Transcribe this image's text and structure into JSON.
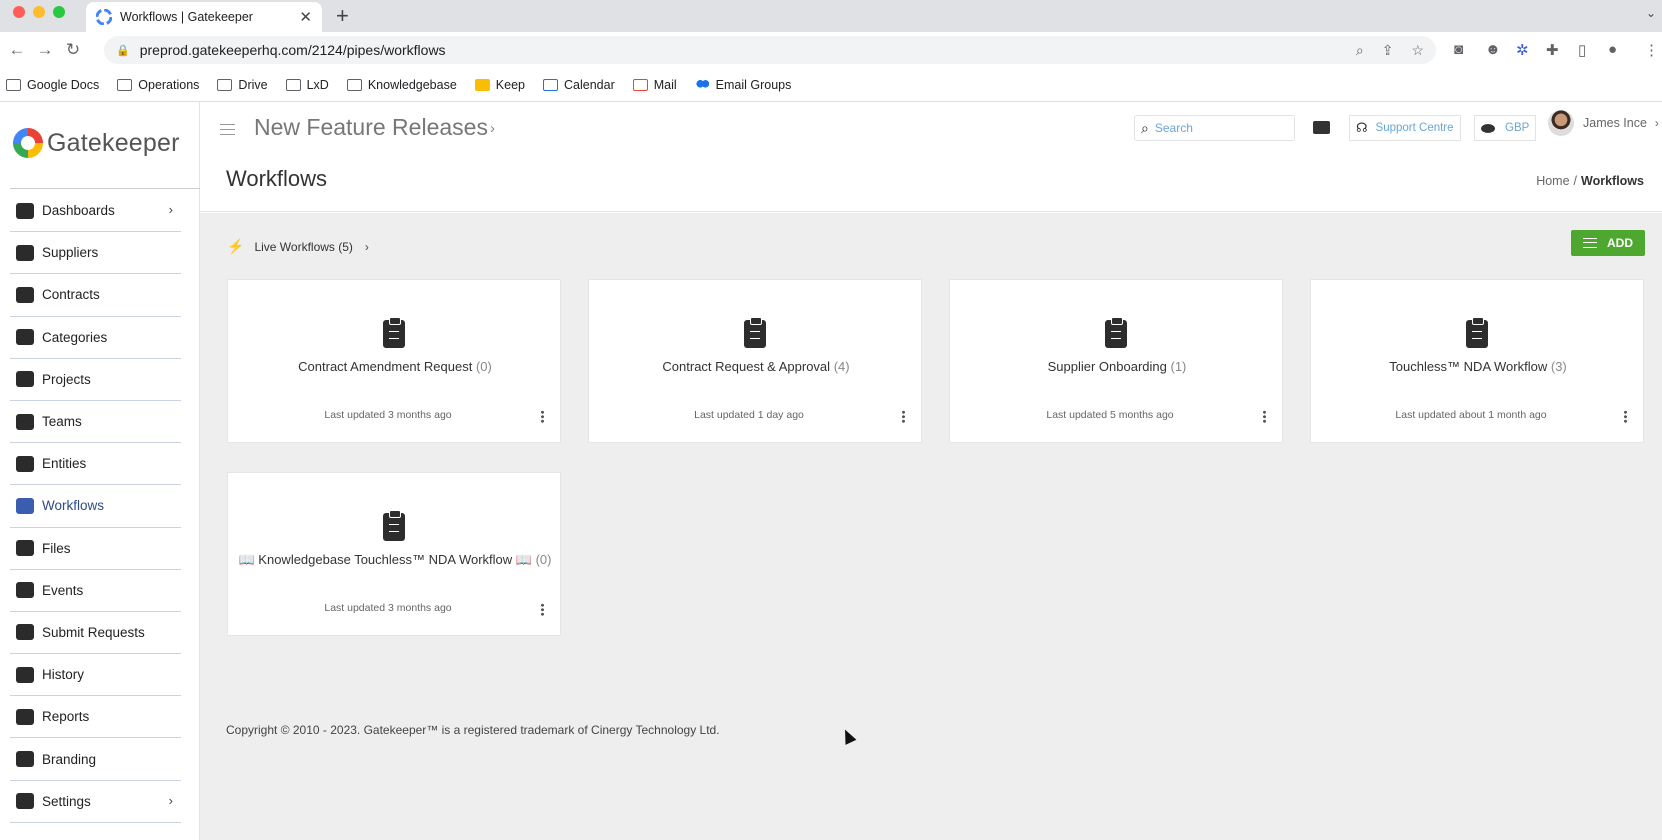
{
  "browser": {
    "tab_title": "Workflows | Gatekeeper",
    "url": "preprod.gatekeeperhq.com/2124/pipes/workflows",
    "bookmarks": [
      {
        "label": "Google Docs",
        "icon": "folder-icon"
      },
      {
        "label": "Operations",
        "icon": "folder-icon"
      },
      {
        "label": "Drive",
        "icon": "folder-icon"
      },
      {
        "label": "LxD",
        "icon": "folder-icon"
      },
      {
        "label": "Knowledgebase",
        "icon": "folder-icon"
      },
      {
        "label": "Keep",
        "icon": "keep-icon"
      },
      {
        "label": "Calendar",
        "icon": "calendar-icon"
      },
      {
        "label": "Mail",
        "icon": "gmail-icon"
      },
      {
        "label": "Email Groups",
        "icon": "groups-icon"
      }
    ]
  },
  "brand": {
    "name": "Gatekeeper",
    "accent": "#4ea72f"
  },
  "sidebar": {
    "items": [
      {
        "label": "Dashboards",
        "icon": "dashboard-icon",
        "has_submenu": true
      },
      {
        "label": "Suppliers",
        "icon": "supplier-icon"
      },
      {
        "label": "Contracts",
        "icon": "contract-icon"
      },
      {
        "label": "Categories",
        "icon": "layers-icon"
      },
      {
        "label": "Projects",
        "icon": "projects-icon"
      },
      {
        "label": "Teams",
        "icon": "teams-icon"
      },
      {
        "label": "Entities",
        "icon": "bank-icon"
      },
      {
        "label": "Workflows",
        "icon": "workflow-icon",
        "active": true
      },
      {
        "label": "Files",
        "icon": "files-icon"
      },
      {
        "label": "Events",
        "icon": "calendar-icon"
      },
      {
        "label": "Submit Requests",
        "icon": "checklist-icon"
      },
      {
        "label": "History",
        "icon": "history-icon"
      },
      {
        "label": "Reports",
        "icon": "chart-icon"
      },
      {
        "label": "Branding",
        "icon": "compass-icon"
      },
      {
        "label": "Settings",
        "icon": "gear-icon",
        "has_submenu": true
      }
    ]
  },
  "topbar": {
    "project": "New Feature Releases",
    "search_placeholder": "Search",
    "support": "Support Centre",
    "currency": "GBP",
    "user": "James Ince"
  },
  "page": {
    "title": "Workflows",
    "breadcrumb": [
      "Home",
      "Workflows"
    ]
  },
  "workflows_bar": {
    "live_label": "Live Workflows (5)",
    "add_label": "ADD"
  },
  "cards": [
    {
      "title": "Contract Amendment Request",
      "count": "(0)",
      "updated": "Last updated 3 months ago"
    },
    {
      "title": "Contract Request & Approval",
      "count": "(4)",
      "updated": "Last updated 1 day ago"
    },
    {
      "title": "Supplier Onboarding",
      "count": "(1)",
      "updated": "Last updated 5 months ago"
    },
    {
      "title": "Touchless™ NDA Workflow",
      "count": "(3)",
      "updated": "Last updated about 1 month ago"
    },
    {
      "title": "📖 Knowledgebase Touchless™ NDA Workflow 📖",
      "count": "(0)",
      "updated": "Last updated 3 months ago"
    }
  ],
  "footer": {
    "copyright": "Copyright © 2010 - 2023. Gatekeeper™ is a registered trademark of Cinergy Technology Ltd."
  }
}
